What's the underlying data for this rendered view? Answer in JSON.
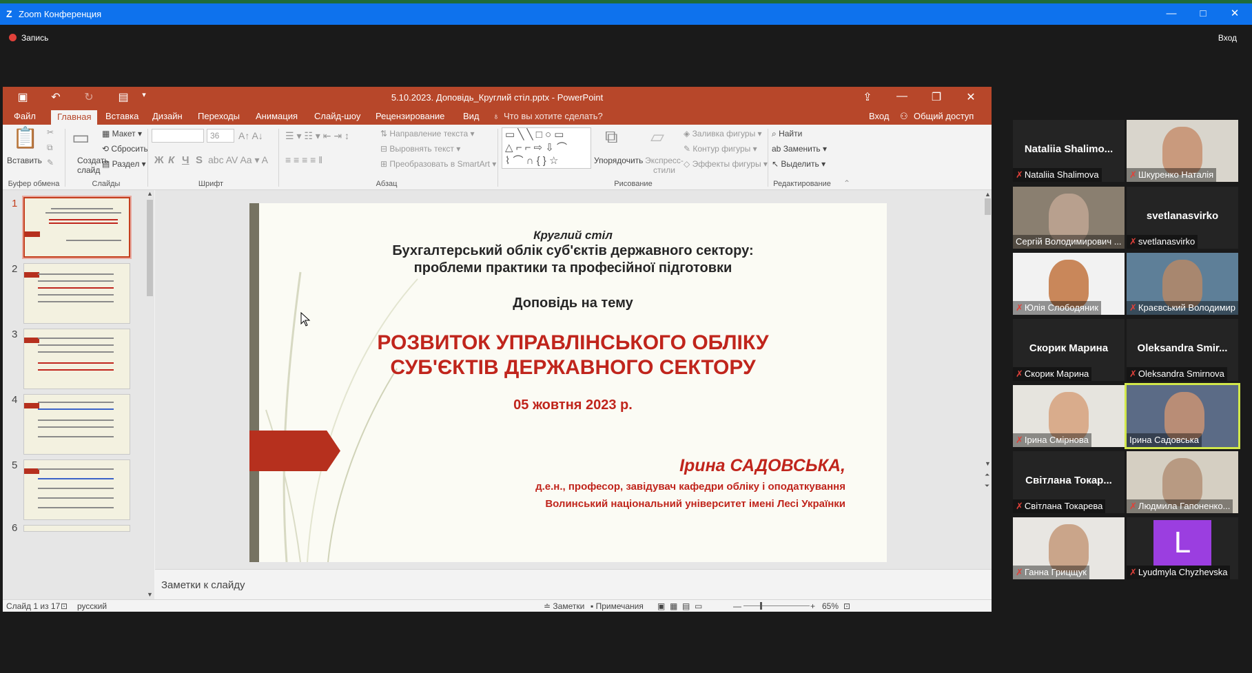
{
  "zoom": {
    "title": "Zoom Конференция",
    "logo": "Z",
    "record_label": "Запись",
    "enter_label": "Вход",
    "window_controls": {
      "minimize": "—",
      "maximize": "□",
      "close": "✕"
    }
  },
  "ppt": {
    "filename": "5.10.2023. Доповідь_Круглий стіл.pptx - PowerPoint",
    "quick_icons": [
      "save-icon",
      "undo-icon",
      "redo-icon",
      "present-icon",
      "customize-icon"
    ],
    "tabs": [
      "Файл",
      "Главная",
      "Вставка",
      "Дизайн",
      "Переходы",
      "Анимация",
      "Слайд-шоу",
      "Рецензирование",
      "Вид"
    ],
    "active_tab": "Главная",
    "tell_me": "Что вы хотите сделать?",
    "signin": "Вход",
    "share": "Общий доступ",
    "ribbon": {
      "paste": "Вставить",
      "create_slide": "Создать слайд",
      "layout": "Макет",
      "reset": "Сбросить",
      "section": "Раздел",
      "font_name": "",
      "font_size": "36",
      "bold": "Ж",
      "italic": "К",
      "underline": "Ч",
      "strike": "S",
      "text_dir": "Направление текста",
      "align_text": "Выровнять текст",
      "smartart": "Преобразовать в SmartArt",
      "arrange": "Упорядочить",
      "quick_styles": "Экспресс-стили",
      "fill": "Заливка фигуры",
      "outline": "Контур фигуры",
      "effects": "Эффекты фигуры",
      "find": "Найти",
      "replace": "Заменить",
      "select": "Выделить",
      "groups": [
        "Буфер обмена",
        "Слайды",
        "Шрифт",
        "Абзац",
        "Рисование",
        "Редактирование"
      ]
    },
    "thumbnails": [
      "1",
      "2",
      "3",
      "4",
      "5",
      "6"
    ],
    "slide": {
      "l1": "Круглий стіл",
      "l2": "Бухгалтерський облік суб'єктів державного сектору:",
      "l3": "проблеми практики та професійної підготовки",
      "l4": "Доповідь на тему",
      "l5": "РОЗВИТОК УПРАВЛІНСЬКОГО ОБЛІКУ",
      "l6": "СУБ'ЄКТІВ ДЕРЖАВНОГО СЕКТОРУ",
      "l7": "05 жовтня 2023 р.",
      "l8": "Ірина САДОВСЬКА,",
      "l9": "д.е.н., професор, завідувач кафедри обліку і оподаткування",
      "l10": "Волинський національний університет імені Лесі Українки"
    },
    "notes_placeholder": "Заметки к слайду",
    "status": {
      "slide": "Слайд 1 из 17",
      "lang": "русский",
      "notes": "Заметки",
      "comments": "Примечания",
      "zoom": "65%"
    }
  },
  "participants": [
    {
      "name": "Nataliia  Shalimo...",
      "label": "Nataliia Shalimova",
      "video": false
    },
    {
      "name": "",
      "label": "Шкуренко Наталія",
      "video": true
    },
    {
      "name": "",
      "label": "Сергій Володимирович ...",
      "video": true
    },
    {
      "name": "svetlanasvirko",
      "label": "svetlanasvirko",
      "video": false
    },
    {
      "name": "",
      "label": "Юлія Слободяник",
      "video": true
    },
    {
      "name": "",
      "label": "Краєвський Володимир",
      "video": true
    },
    {
      "name": "Скорик Марина",
      "label": "Скорик Марина",
      "video": false
    },
    {
      "name": "Oleksandra  Smir...",
      "label": "Oleksandra Smirnova",
      "video": false
    },
    {
      "name": "",
      "label": "Ірина Смірнова",
      "video": true
    },
    {
      "name": "",
      "label": "Ірина Садовська",
      "video": true
    },
    {
      "name": "Світлана  Токар...",
      "label": "Світлана Токарева",
      "video": false
    },
    {
      "name": "",
      "label": "Людмила Гапоненко...",
      "video": true
    },
    {
      "name": "",
      "label": "Ганна Грицщук",
      "video": true
    },
    {
      "name": "",
      "label": "Lyudmyla Chyzhevska",
      "video": false,
      "avatar": "L"
    }
  ],
  "colors": {
    "zoom_blue": "#0e72ed",
    "ppt_red": "#b7472a",
    "slide_red": "#c0251c",
    "speaker_highlight": "#d2e84a"
  }
}
